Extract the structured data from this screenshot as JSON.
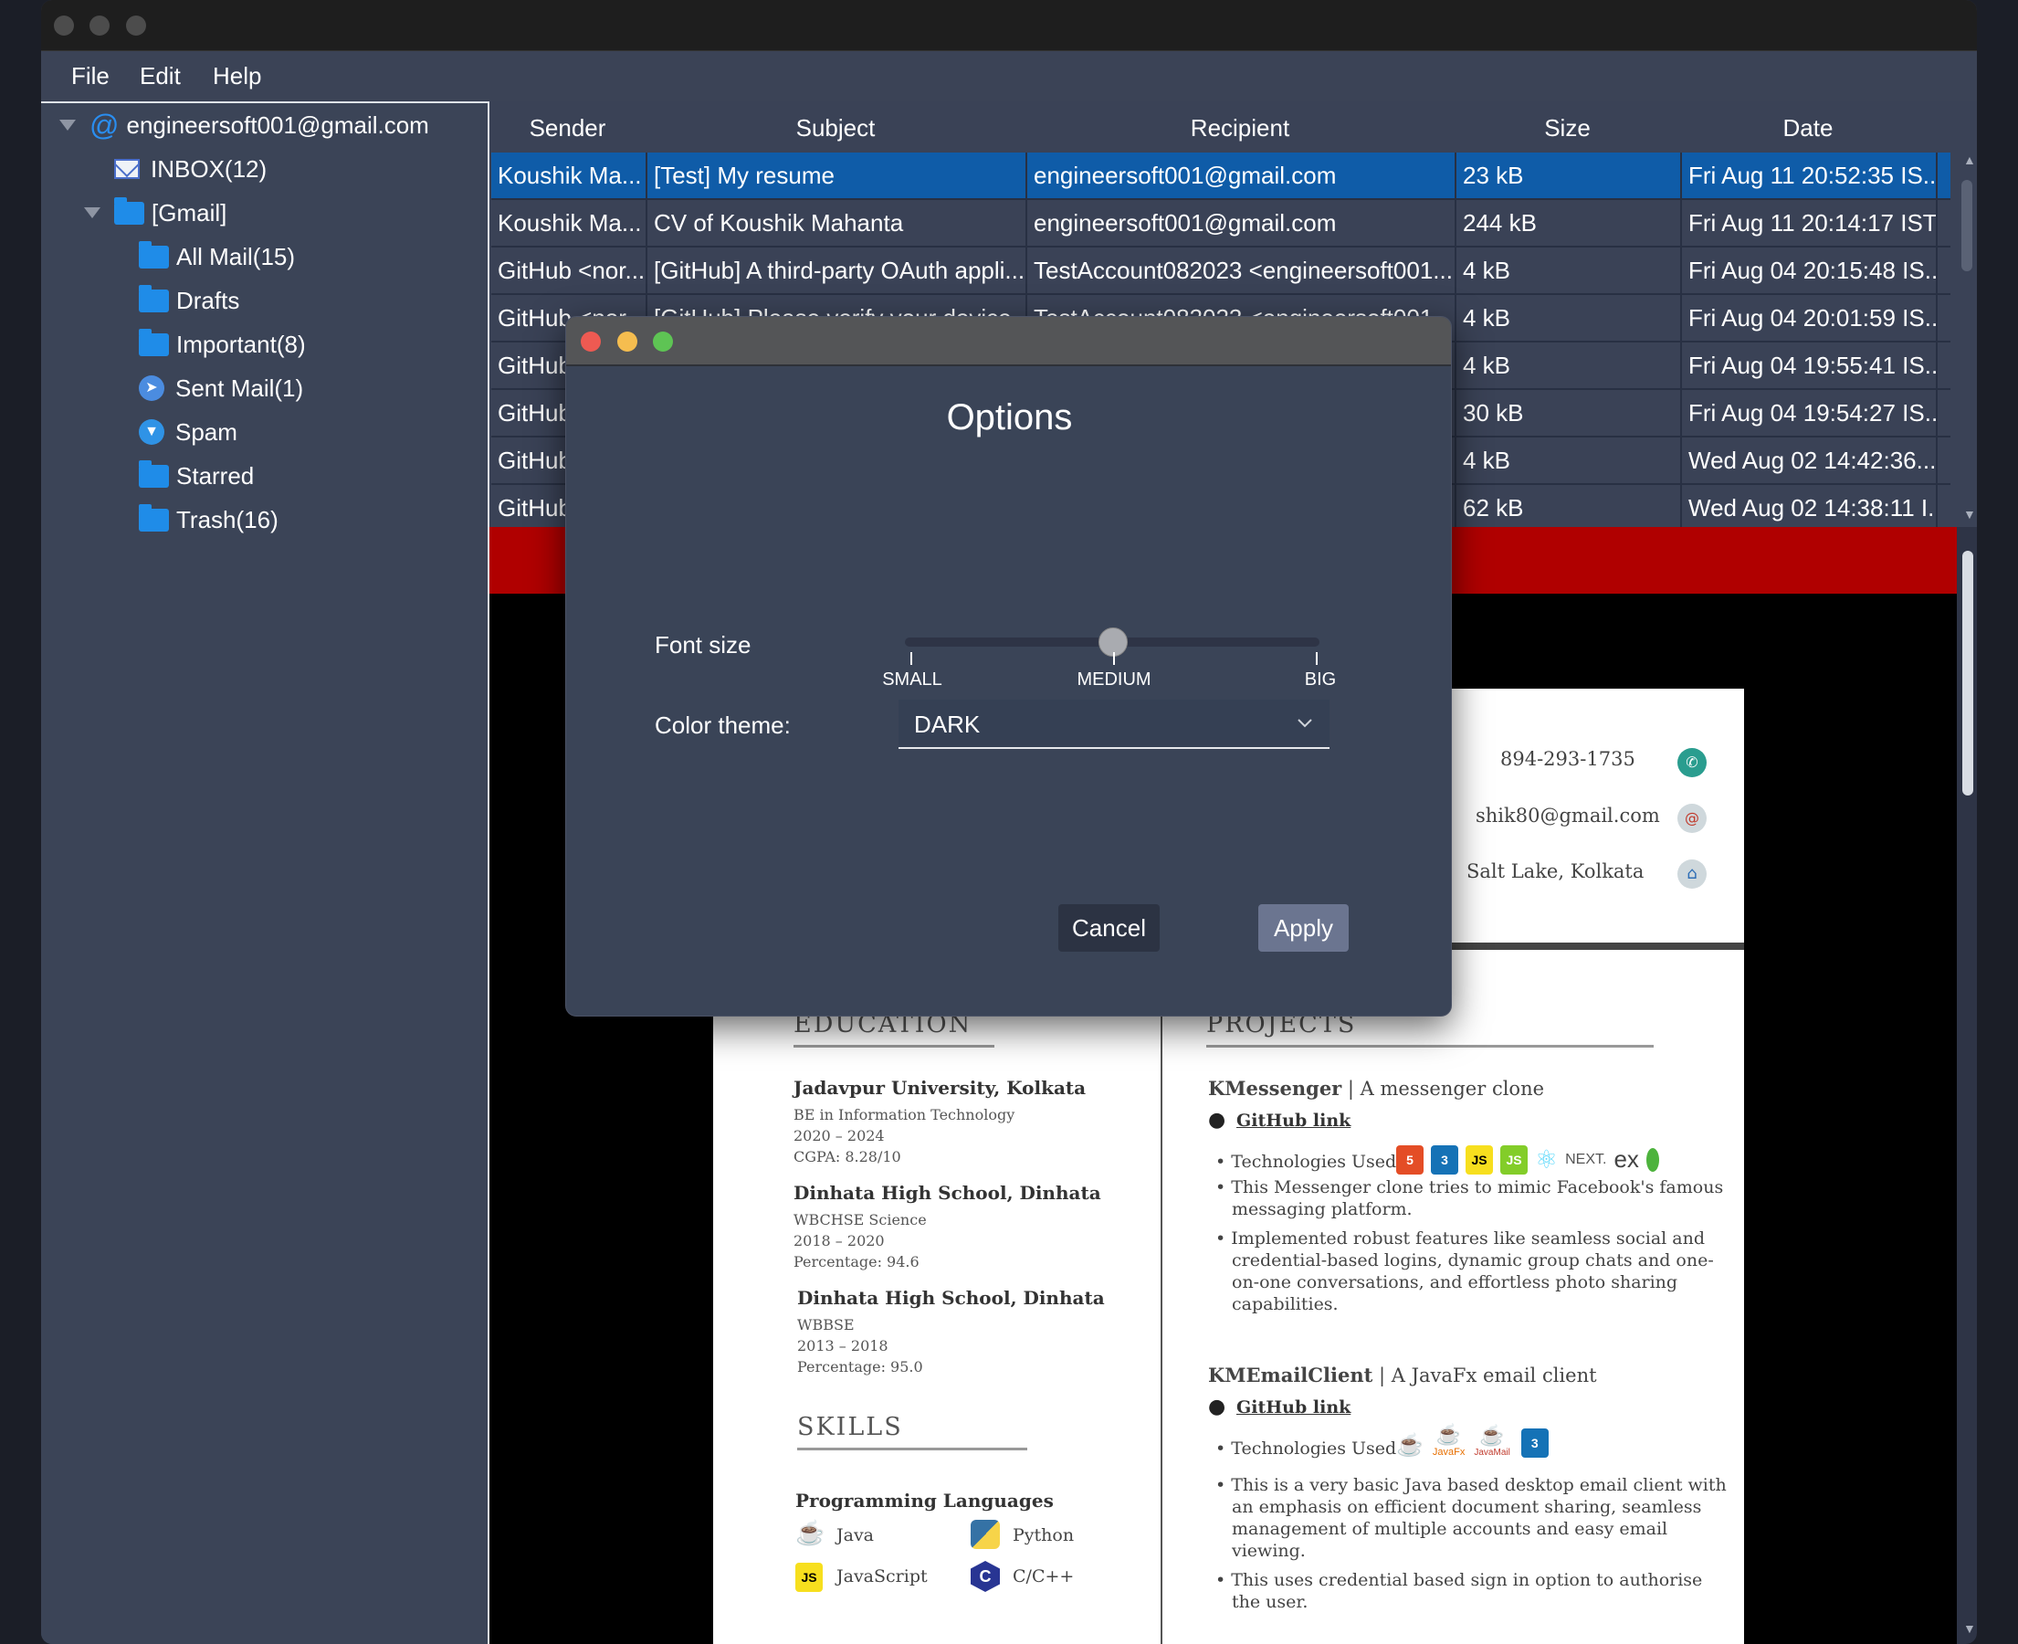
{
  "menu": {
    "file": "File",
    "edit": "Edit",
    "help": "Help"
  },
  "tree": {
    "account": "engineersoft001@gmail.com",
    "inbox": "INBOX(12)",
    "gmail": "[Gmail]",
    "all_mail": "All Mail(15)",
    "drafts": "Drafts",
    "important": "Important(8)",
    "sent": "Sent Mail(1)",
    "spam": "Spam",
    "starred": "Starred",
    "trash": "Trash(16)"
  },
  "table": {
    "columns": {
      "sender": "Sender",
      "subject": "Subject",
      "recipient": "Recipient",
      "size": "Size",
      "date": "Date"
    },
    "rows": [
      {
        "sender": "Koushik Ma...",
        "subject": "[Test] My resume",
        "recipient": "engineersoft001@gmail.com",
        "size": "23 kB",
        "date": "Fri Aug 11 20:52:35 IS..."
      },
      {
        "sender": "Koushik Ma...",
        "subject": "CV of Koushik Mahanta",
        "recipient": "engineersoft001@gmail.com",
        "size": "244 kB",
        "date": "Fri Aug 11 20:14:17 IST..."
      },
      {
        "sender": "GitHub <nor...",
        "subject": "[GitHub] A third-party OAuth appli...",
        "recipient": "TestAccount082023 <engineersoft001...",
        "size": "4 kB",
        "date": "Fri Aug 04 20:15:48 IS..."
      },
      {
        "sender": "GitHub <nor...",
        "subject": "[GitHub] Please verify your device",
        "recipient": "TestAccount082023 <engineersoft001...",
        "size": "4 kB",
        "date": "Fri Aug 04 20:01:59 IS..."
      },
      {
        "sender": "GitHub",
        "subject": "",
        "recipient": "",
        "size": "4 kB",
        "date": "Fri Aug 04 19:55:41 IS..."
      },
      {
        "sender": "GitHub",
        "subject": "",
        "recipient": "",
        "size": "30 kB",
        "date": "Fri Aug 04 19:54:27 IS..."
      },
      {
        "sender": "GitHub",
        "subject": "",
        "recipient": "",
        "size": "4 kB",
        "date": "Wed Aug 02 14:42:36..."
      },
      {
        "sender": "GitHub",
        "subject": "",
        "recipient": "",
        "size": "62 kB",
        "date": "Wed Aug 02 14:38:11 I..."
      }
    ]
  },
  "resume": {
    "phone": "894-293-1735",
    "email": "shik80@gmail.com",
    "address": "Salt Lake, Kolkata",
    "education_title": "EDUCATION",
    "edu1_school": "Jadavpur University, Kolkata",
    "edu1_degree": "BE in Information Technology",
    "edu1_years": "2020 – 2024",
    "edu1_grade": "CGPA: 8.28/10",
    "edu2_school": "Dinhata High School, Dinhata",
    "edu2_degree": "WBCHSE Science",
    "edu2_years": "2018 – 2020",
    "edu2_grade": "Percentage: 94.6",
    "edu3_school": "Dinhata High School, Dinhata",
    "edu3_degree": "WBBSE",
    "edu3_years": "2013 – 2018",
    "edu3_grade": "Percentage: 95.0",
    "skills_title": "SKILLS",
    "prog_lang": "Programming Languages",
    "lang_java": "Java",
    "lang_python": "Python",
    "lang_js": "JavaScript",
    "lang_c": "C/C++",
    "projects_title": "PROJECTS",
    "p1_name": "KMessenger",
    "p1_desc": " | A messenger clone",
    "github_link": "GitHub link",
    "tech_used": "Technologies Used :",
    "p1_b1_l1": "This Messenger clone tries to mimic Facebook's famous",
    "p1_b1_l2": "messaging platform.",
    "p1_b2_l1": "Implemented robust features like seamless social and",
    "p1_b2_l2": "credential-based logins, dynamic group chats and one-",
    "p1_b2_l3": "on-one conversations, and effortless photo sharing",
    "p1_b2_l4": "capabilities.",
    "p2_name": "KMEmailClient",
    "p2_desc": " | A JavaFx email client",
    "p2_b1_l1": "This is a very basic Java based desktop email client with",
    "p2_b1_l2": "an emphasis on efficient document sharing, seamless",
    "p2_b1_l3": "management of multiple accounts and easy email",
    "p2_b1_l4": "viewing.",
    "p2_b2_l1": "This uses credential based sign in option to authorise",
    "p2_b2_l2": "the user.",
    "next_label": "NEXT.",
    "ex_label": "ex",
    "javafx_label": "JavaFx",
    "javamail_label": "JavaMail"
  },
  "dialog": {
    "title": "Options",
    "font_size_label": "Font size",
    "ticks": [
      "SMALL",
      "MEDIUM",
      "BIG"
    ],
    "font_size_value": 0.5,
    "color_theme_label": "Color theme:",
    "color_theme_value": "DARK",
    "cancel": "Cancel",
    "apply": "Apply"
  }
}
